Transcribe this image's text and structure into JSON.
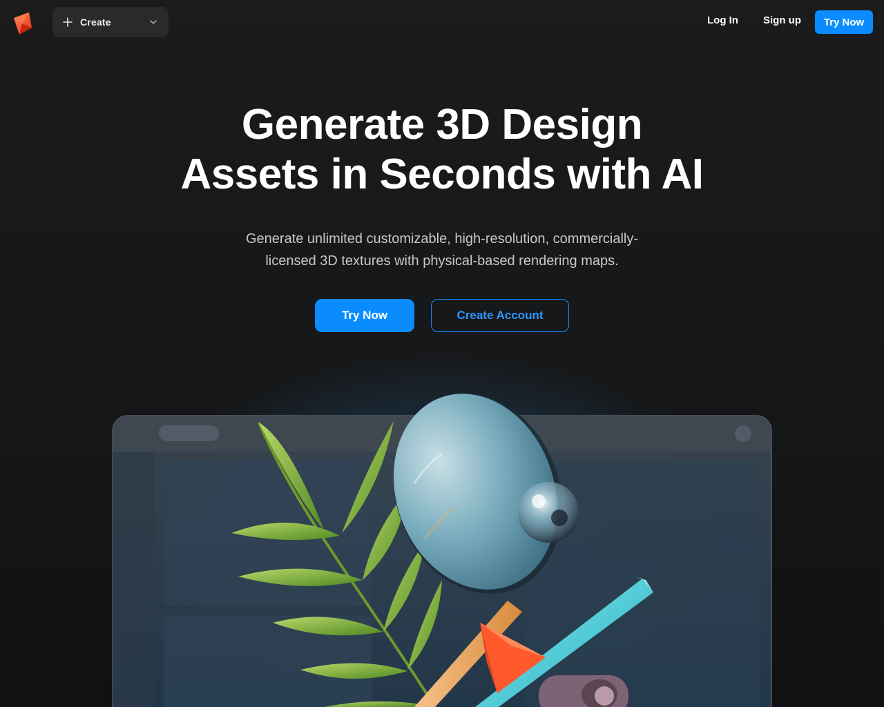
{
  "nav": {
    "create_label": "Create",
    "login_label": "Log In",
    "signup_label": "Sign up",
    "try_label": "Try Now"
  },
  "hero": {
    "title_line1": "Generate 3D Design",
    "title_line2": "Assets in Seconds with AI",
    "subtitle_line1": "Generate unlimited customizable, high-resolution, commercially-",
    "subtitle_line2": "licensed 3D textures with physical-based rendering maps.",
    "primary_cta": "Try Now",
    "secondary_cta": "Create Account"
  },
  "colors": {
    "accent": "#0a8cff",
    "background": "#1b1b1c",
    "logo": "#ff5a36"
  },
  "icons": {
    "logo": "3d-cube-logo-icon",
    "create": "plus-icon",
    "create_dropdown": "chevron-down-icon"
  }
}
